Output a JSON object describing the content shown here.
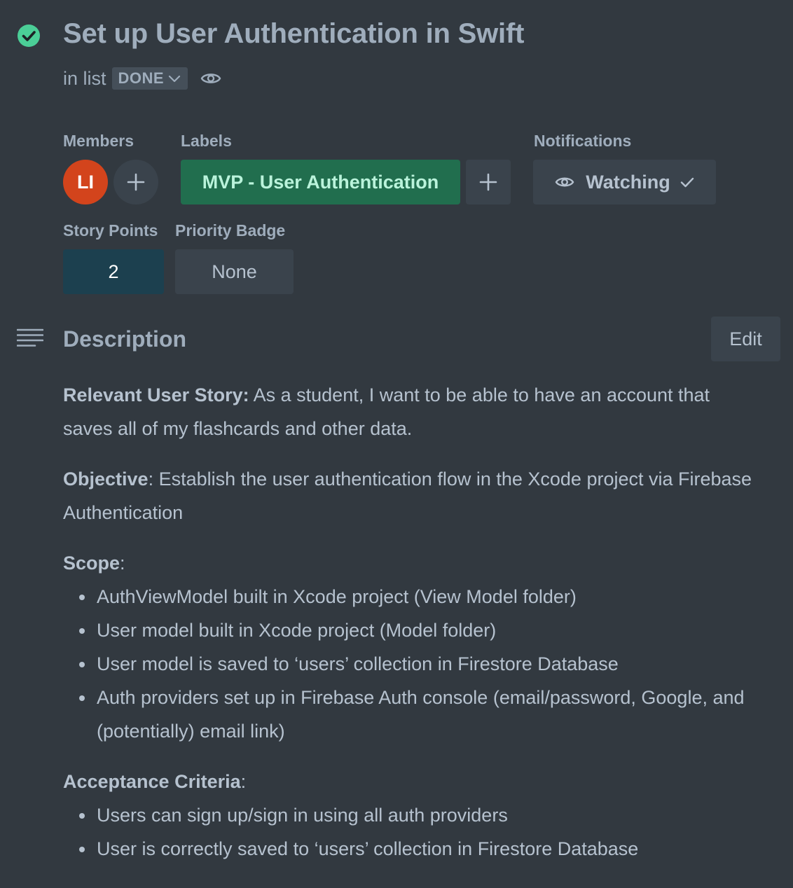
{
  "card": {
    "title": "Set up User Authentication in Swift",
    "in_list_prefix": "in list",
    "list_name": "DONE",
    "status_icon": "check-circle-icon",
    "status_color": "#4bce97"
  },
  "members": {
    "label": "Members",
    "avatar_initials": "LI",
    "avatar_color": "#d3441c"
  },
  "labels": {
    "label": "Labels",
    "items": [
      {
        "text": "MVP - User Authentication",
        "color": "#216e4e"
      }
    ]
  },
  "notifications": {
    "label": "Notifications",
    "watch_label": "Watching"
  },
  "story_points": {
    "label": "Story Points",
    "value": "2"
  },
  "priority": {
    "label": "Priority Badge",
    "value": "None"
  },
  "description": {
    "heading": "Description",
    "edit_label": "Edit",
    "story_label": "Relevant User Story:",
    "story_text": " As a student, I want to be able to have an account that saves all of my flashcards and other data.",
    "objective_label": "Objective",
    "objective_text": ": Establish the user authentication flow in the Xcode project via Firebase Authentication",
    "scope_label": "Scope",
    "scope_suffix": ":",
    "scope_items": [
      "AuthViewModel built in Xcode project (View Model folder)",
      "User model built in Xcode project (Model folder)",
      "User model is saved to ‘users’ collection in Firestore Database",
      "Auth providers set up in Firebase Auth console (email/password, Google, and (potentially) email link)"
    ],
    "criteria_label": "Acceptance Criteria",
    "criteria_suffix": ":",
    "criteria_items": [
      "Users can sign up/sign in using all auth providers",
      "User is correctly saved to ‘users’ collection in Firestore Database"
    ]
  }
}
